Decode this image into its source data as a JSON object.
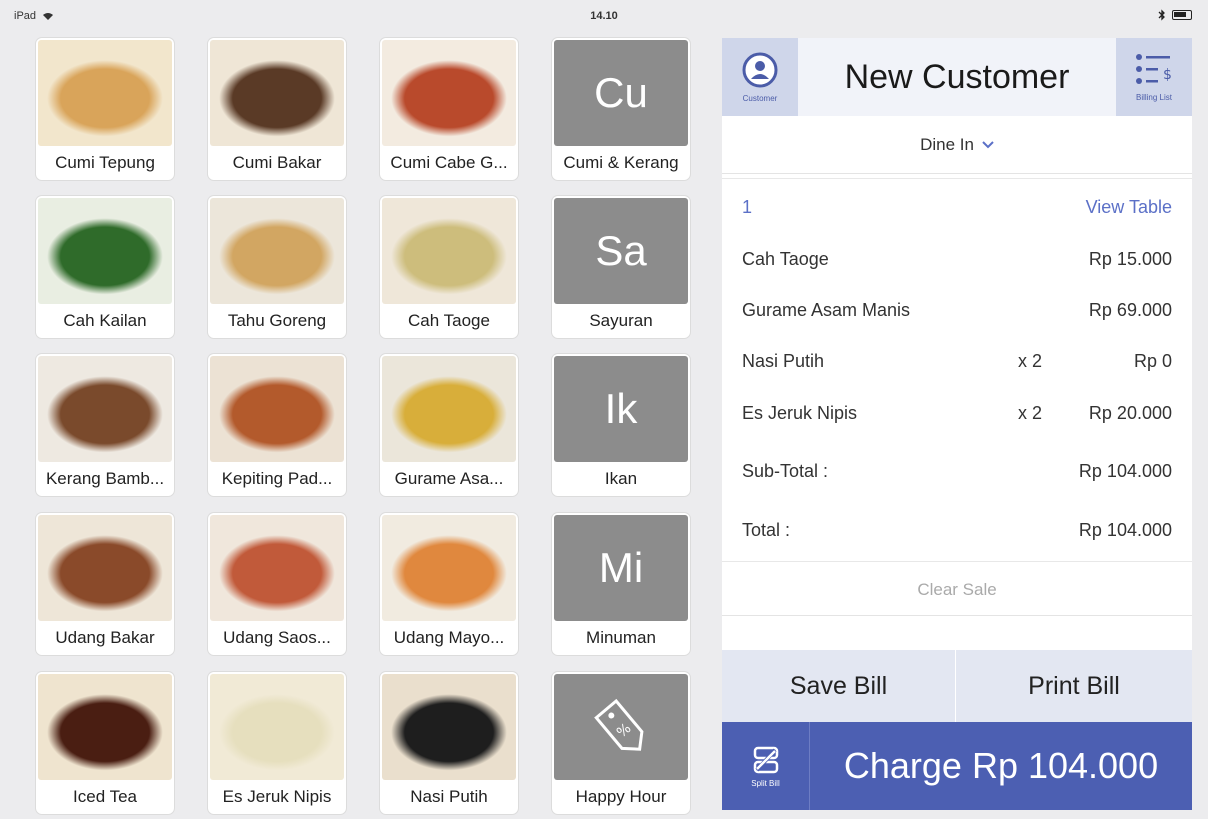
{
  "status_bar": {
    "device": "iPad",
    "time": "14.10"
  },
  "menu_items": [
    {
      "label": "Cumi Tepung",
      "type": "food",
      "icon": "fried-calamari-photo"
    },
    {
      "label": "Cumi Bakar",
      "type": "food",
      "icon": "grilled-squid-photo"
    },
    {
      "label": "Cumi Cabe G...",
      "type": "food",
      "icon": "chili-squid-photo"
    },
    {
      "label": "Cumi & Kerang",
      "type": "category",
      "abbr": "Cu"
    },
    {
      "label": "Cah Kailan",
      "type": "food",
      "icon": "kailan-vegetable-photo"
    },
    {
      "label": "Tahu Goreng",
      "type": "food",
      "icon": "fried-tofu-photo"
    },
    {
      "label": "Cah Taoge",
      "type": "food",
      "icon": "bean-sprouts-photo"
    },
    {
      "label": "Sayuran",
      "type": "category",
      "abbr": "Sa"
    },
    {
      "label": "Kerang Bamb...",
      "type": "food",
      "icon": "clams-photo"
    },
    {
      "label": "Kepiting Pad...",
      "type": "food",
      "icon": "crab-photo"
    },
    {
      "label": "Gurame Asa...",
      "type": "food",
      "icon": "gourami-fish-photo"
    },
    {
      "label": "Ikan",
      "type": "category",
      "abbr": "Ik"
    },
    {
      "label": "Udang Bakar",
      "type": "food",
      "icon": "grilled-shrimp-photo"
    },
    {
      "label": "Udang Saos...",
      "type": "food",
      "icon": "shrimp-sauce-photo"
    },
    {
      "label": "Udang Mayo...",
      "type": "food",
      "icon": "shrimp-mayo-photo"
    },
    {
      "label": "Minuman",
      "type": "category",
      "abbr": "Mi"
    },
    {
      "label": "Iced Tea",
      "type": "food",
      "icon": "iced-tea-photo"
    },
    {
      "label": "Es Jeruk Nipis",
      "type": "food",
      "icon": "lime-juice-photo"
    },
    {
      "label": "Nasi Putih",
      "type": "food",
      "icon": "white-rice-photo"
    },
    {
      "label": "Happy Hour",
      "type": "tag",
      "icon": "discount-tag-icon"
    }
  ],
  "customer": {
    "button_caption": "Customer",
    "title": "New Customer",
    "billing_caption": "Billing List"
  },
  "dine_in": "Dine In",
  "order": {
    "table_number": "1",
    "view_table": "View Table",
    "items": [
      {
        "name": "Cah Taoge",
        "qty": "",
        "price": "Rp 15.000"
      },
      {
        "name": "Gurame Asam Manis",
        "qty": "",
        "price": "Rp 69.000"
      },
      {
        "name": "Nasi Putih",
        "qty": "x 2",
        "price": "Rp 0"
      },
      {
        "name": "Es Jeruk Nipis",
        "qty": "x 2",
        "price": "Rp 20.000"
      }
    ],
    "subtotal_label": "Sub-Total :",
    "subtotal_value": "Rp 104.000",
    "total_label": "Total :",
    "total_value": "Rp 104.000"
  },
  "clear_sale": "Clear Sale",
  "save_bill": "Save Bill",
  "print_bill": "Print Bill",
  "split_caption": "Split Bill",
  "charge": "Charge Rp 104.000",
  "colors": {
    "accent": "#4c5fb2",
    "category_tile": "#8c8c8c",
    "link": "#5b70c7"
  }
}
